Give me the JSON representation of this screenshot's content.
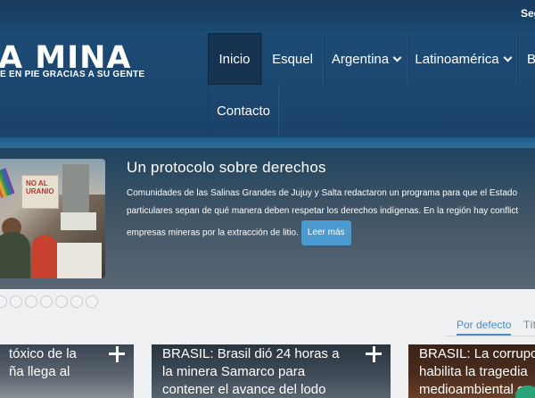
{
  "topbar": {
    "right_link": "Seguinos"
  },
  "header": {
    "logo_title": "A MINA",
    "logo_sub": "E EN PIE GRACIAS A SU GENTE"
  },
  "nav": {
    "items": [
      {
        "label": "Inicio",
        "active": true
      },
      {
        "label": "Esquel"
      },
      {
        "label": "Argentina",
        "dropdown": true
      },
      {
        "label": "Latinoamérica",
        "dropdown": true
      },
      {
        "label": "B"
      },
      {
        "label": "Contacto"
      }
    ]
  },
  "slider": {
    "title": "Un protocolo sobre derechos",
    "text_lines": [
      "Comunidades de las Salinas Grandes de Jujuy y Salta redactaron un programa para que el Estado",
      "particulares sepan de qué manera deben respetar los derechos indígenas. En la región hay conflict",
      "empresas mineras por la extracción de litio."
    ],
    "read_more": "Leer más",
    "image_banner_text": "NO AL\nURANIO",
    "dot_count": 7
  },
  "sort": {
    "default_label": "Por defecto",
    "second_label": "Títu"
  },
  "cards": [
    {
      "lines": [
        "tóxico de la",
        "ña llega al"
      ]
    },
    {
      "lines": [
        "BRASIL: Brasil dió 24 horas a",
        "la minera Samarco para",
        "contener el avance del lodo"
      ]
    },
    {
      "lines": [
        "BRASIL: La corrupc",
        "habilita la tragedia",
        "medioambiental en"
      ]
    }
  ],
  "colors": {
    "topbar": "#163a5c",
    "header": "#1c4670",
    "nav_active": "#163352",
    "read_more": "#4a9ad0",
    "sort_active": "#4a8cc0"
  }
}
